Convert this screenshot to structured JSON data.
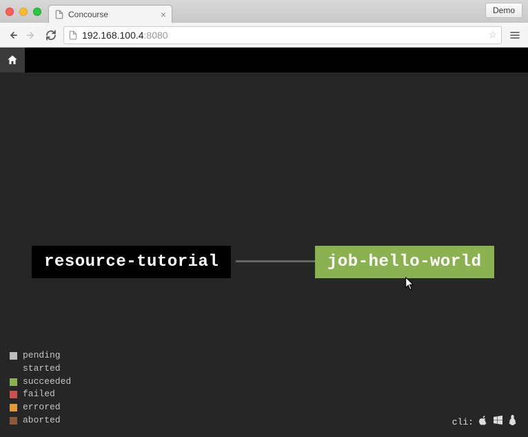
{
  "browser": {
    "tab_title": "Concourse",
    "demo_label": "Demo",
    "address_host": "192.168.100.4",
    "address_port": ":8080"
  },
  "pipeline": {
    "resource_label": "resource-tutorial",
    "job_label": "job-hello-world"
  },
  "legend": {
    "items": [
      {
        "key": "pending",
        "label": "pending"
      },
      {
        "key": "started",
        "label": "started"
      },
      {
        "key": "succeeded",
        "label": "succeeded"
      },
      {
        "key": "failed",
        "label": "failed"
      },
      {
        "key": "errored",
        "label": "errored"
      },
      {
        "key": "aborted",
        "label": "aborted"
      }
    ]
  },
  "cli": {
    "label": "cli:"
  }
}
